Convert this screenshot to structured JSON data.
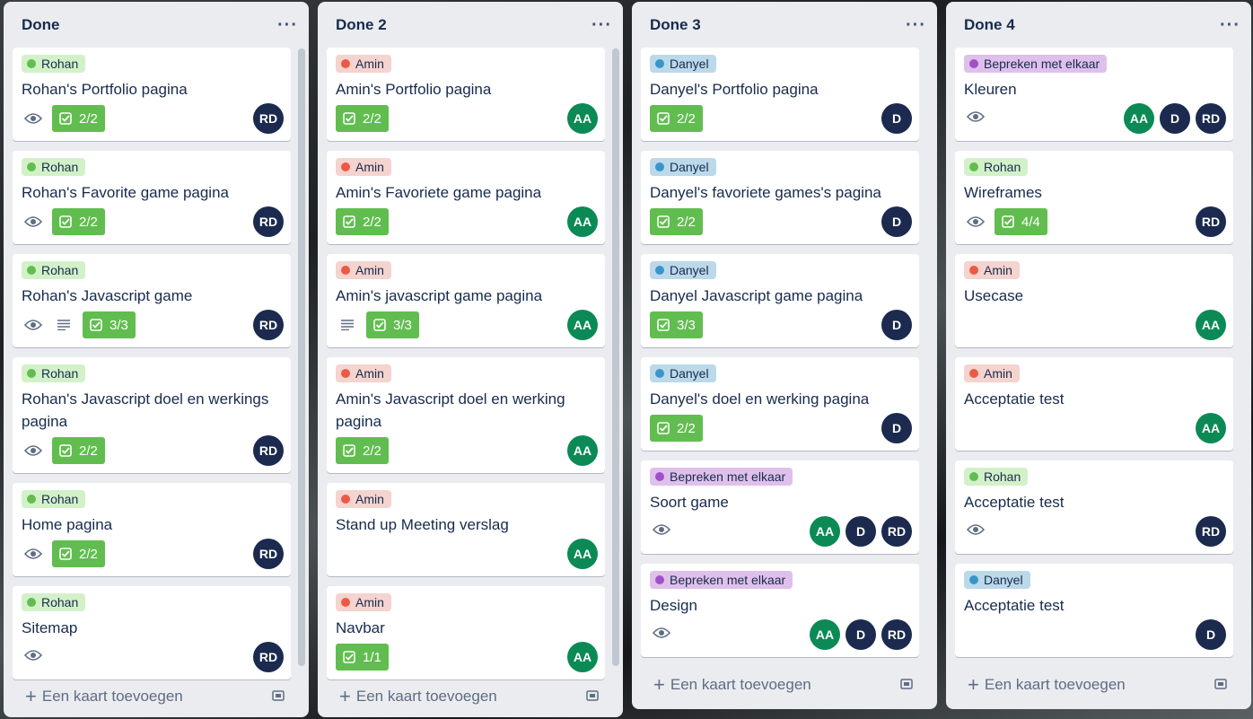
{
  "lists": [
    {
      "title": "Done",
      "add_label": "Een kaart toevoegen",
      "cards": [
        {
          "label": "Rohan",
          "title": "Rohan's Portfolio pagina",
          "check": "2/2"
        },
        {
          "label": "Rohan",
          "title": "Rohan's Favorite game pagina",
          "check": "2/2"
        },
        {
          "label": "Rohan",
          "title": "Rohan's Javascript game",
          "check": "3/3"
        },
        {
          "label": "Rohan",
          "title": "Rohan's Javascript doel en werkings pagina",
          "check": "2/2"
        },
        {
          "label": "Rohan",
          "title": "Home pagina",
          "check": "2/2"
        },
        {
          "label": "Rohan",
          "title": "Sitemap"
        }
      ]
    },
    {
      "title": "Done 2",
      "add_label": "Een kaart toevoegen",
      "cards": [
        {
          "label": "Amin",
          "title": "Amin's Portfolio pagina",
          "check": "2/2"
        },
        {
          "label": "Amin",
          "title": "Amin's Favoriete game pagina",
          "check": "2/2"
        },
        {
          "label": "Amin",
          "title": "Amin's javascript game pagina",
          "check": "3/3"
        },
        {
          "label": "Amin",
          "title": "Amin's Javascript doel en werking pagina",
          "check": "2/2"
        },
        {
          "label": "Amin",
          "title": "Stand up Meeting verslag"
        },
        {
          "label": "Amin",
          "title": "Navbar",
          "check": "1/1"
        }
      ]
    },
    {
      "title": "Done 3",
      "add_label": "Een kaart toevoegen",
      "cards": [
        {
          "label": "Danyel",
          "title": "Danyel's Portfolio pagina",
          "check": "2/2"
        },
        {
          "label": "Danyel",
          "title": "Danyel's favoriete games's pagina",
          "check": "2/2"
        },
        {
          "label": "Danyel",
          "title": "Danyel Javascript game pagina",
          "check": "3/3"
        },
        {
          "label": "Danyel",
          "title": "Danyel's doel en werking pagina",
          "check": "2/2"
        },
        {
          "label": "Bepreken met elkaar",
          "title": "Soort game"
        },
        {
          "label": "Bepreken met elkaar",
          "title": "Design"
        }
      ]
    },
    {
      "title": "Done 4",
      "add_label": "Een kaart toevoegen",
      "cards": [
        {
          "label": "Bepreken met elkaar",
          "title": "Kleuren"
        },
        {
          "label": "Rohan",
          "title": "Wireframes",
          "check": "4/4"
        },
        {
          "label": "Amin",
          "title": "Usecase"
        },
        {
          "label": "Amin",
          "title": "Acceptatie test"
        },
        {
          "label": "Rohan",
          "title": "Acceptatie test"
        },
        {
          "label": "Danyel",
          "title": "Acceptatie test"
        }
      ]
    }
  ],
  "avatars": {
    "rd": "RD",
    "aa": "AA",
    "d": "D"
  },
  "menu_glyph": "···"
}
